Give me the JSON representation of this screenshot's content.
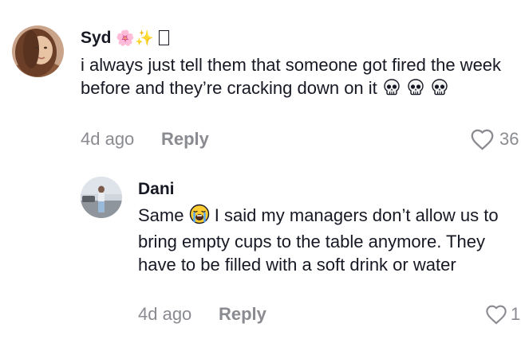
{
  "comments": [
    {
      "username": "Syd",
      "username_decoration": "🌸✨",
      "text_part1": "i always just tell them that someone got fired the week before and they’re cracking down on it",
      "emoji_icons": [
        "skull-icon",
        "skull-icon",
        "skull-icon"
      ],
      "time": "4d ago",
      "reply_label": "Reply",
      "likes": "36"
    },
    {
      "username": "Dani",
      "text_before_emoji": "Same",
      "emoji_icon": "loudly-crying-face-icon",
      "text_after_emoji": "I said my managers don’t allow us to bring empty cups to the table anymore. They have to be filled with a soft drink or water",
      "time": "4d ago",
      "reply_label": "Reply",
      "likes": "1"
    }
  ],
  "colors": {
    "text": "#161823",
    "muted": "#8a8b91"
  }
}
